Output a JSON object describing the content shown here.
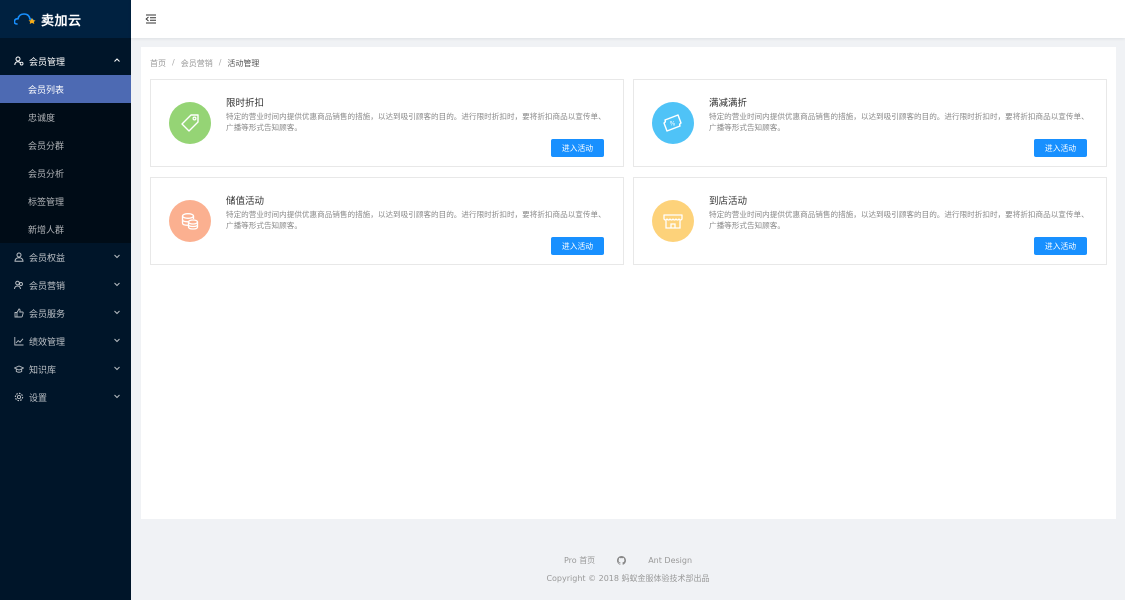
{
  "app": {
    "name": "卖加云"
  },
  "sidebar": {
    "groups": [
      {
        "label": "会员管理",
        "open": true,
        "children": [
          {
            "label": "会员列表",
            "active": true
          },
          {
            "label": "忠诚度"
          },
          {
            "label": "会员分群"
          },
          {
            "label": "会员分析"
          },
          {
            "label": "标签管理"
          },
          {
            "label": "新增人群"
          }
        ]
      },
      {
        "label": "会员权益"
      },
      {
        "label": "会员营销"
      },
      {
        "label": "会员服务"
      },
      {
        "label": "绩效管理"
      },
      {
        "label": "知识库"
      },
      {
        "label": "设置"
      }
    ]
  },
  "breadcrumb": {
    "items": [
      "首页",
      "会员营销",
      "活动管理"
    ],
    "separator": "/"
  },
  "cards": [
    {
      "title": "限时折扣",
      "desc": "特定的营业时间内提供优惠商品销售的措施，以达到吸引顾客的目的。进行限时折扣时，要将折扣商品以宣传单、广播等形式告知顾客。",
      "button": "进入活动",
      "color": "#95d475",
      "icon": "tag-icon"
    },
    {
      "title": "满减满折",
      "desc": "特定的营业时间内提供优惠商品销售的措施，以达到吸引顾客的目的。进行限时折扣时，要将折扣商品以宣传单、广播等形式告知顾客。",
      "button": "进入活动",
      "color": "#4fc3f7",
      "icon": "discount-ticket-icon"
    },
    {
      "title": "储值活动",
      "desc": "特定的营业时间内提供优惠商品销售的措施，以达到吸引顾客的目的。进行限时折扣时，要将折扣商品以宣传单、广播等形式告知顾客。",
      "button": "进入活动",
      "color": "#fbb090",
      "icon": "coins-icon"
    },
    {
      "title": "到店活动",
      "desc": "特定的营业时间内提供优惠商品销售的措施，以达到吸引顾客的目的。进行限时折扣时，要将折扣商品以宣传单、广播等形式告知顾客。",
      "button": "进入活动",
      "color": "#fdd27a",
      "icon": "store-icon"
    }
  ],
  "footer": {
    "links": [
      "Pro 首页",
      "Ant Design"
    ],
    "copyright": "Copyright © 2018 蚂蚁金服体验技术部出品"
  }
}
